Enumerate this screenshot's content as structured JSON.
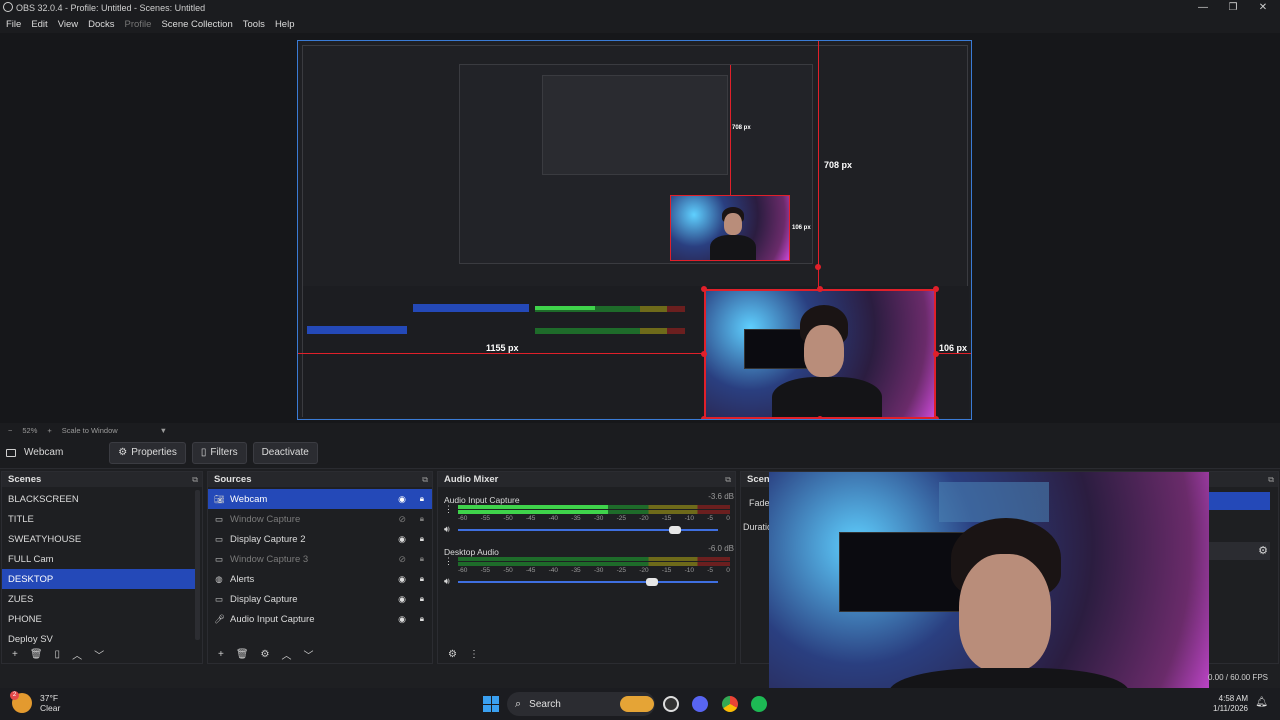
{
  "window": {
    "title": "OBS 32.0.4 - Profile: Untitled - Scenes: Untitled",
    "controls": [
      "—",
      "❐",
      "✕"
    ]
  },
  "menu": [
    "File",
    "Edit",
    "View",
    "Docks",
    "Profile",
    "Scene Collection",
    "Tools",
    "Help"
  ],
  "preview": {
    "measure_top": "708 px",
    "measure_right": "106 px",
    "measure_left": "1155 px",
    "inner_measure": "708 px",
    "inner_measure2": "106 px"
  },
  "zoom": {
    "minus": "−",
    "value": "52%",
    "plus": "+",
    "mode": "Scale to Window",
    "caret": "▼"
  },
  "source_bar": {
    "name": "Webcam",
    "properties": "Properties",
    "filters": "Filters",
    "deactivate": "Deactivate"
  },
  "scenes": {
    "title": "Scenes",
    "items": [
      "BLACKSCREEN",
      "TITLE",
      "SWEATYHOUSE",
      "FULL Cam",
      "DESKTOP",
      "ZUES",
      "PHONE",
      "Deploy SV"
    ],
    "selected": 4
  },
  "sources": {
    "title": "Sources",
    "items": [
      {
        "name": "Webcam",
        "icon": "camera-icon",
        "visible": true,
        "selected": true
      },
      {
        "name": "Window Capture",
        "icon": "window-icon",
        "visible": false
      },
      {
        "name": "Display Capture 2",
        "icon": "display-icon",
        "visible": true
      },
      {
        "name": "Window Capture 3",
        "icon": "window-icon",
        "visible": false
      },
      {
        "name": "Alerts",
        "icon": "globe-icon",
        "visible": true
      },
      {
        "name": "Display Capture",
        "icon": "display-icon",
        "visible": true
      },
      {
        "name": "Audio Input Capture",
        "icon": "mic-icon",
        "visible": true
      }
    ]
  },
  "audio_mixer": {
    "title": "Audio Mixer",
    "channels": [
      {
        "name": "Audio Input Capture",
        "db": "-3.6 dB",
        "level": 0.55,
        "volume": 0.85
      },
      {
        "name": "Desktop Audio",
        "db": "-6.0 dB",
        "level": 0.0,
        "volume": 0.76
      }
    ],
    "scale": [
      "-60",
      "-55",
      "-50",
      "-45",
      "-40",
      "-35",
      "-30",
      "-25",
      "-20",
      "-15",
      "-10",
      "-5",
      "0"
    ]
  },
  "scene_transitions": {
    "title": "Scene",
    "fade": "Fade",
    "duration": "Duratio"
  },
  "status": {
    "fps": "0.00 / 60.00 FPS"
  },
  "taskbar": {
    "weather_temp": "37°F",
    "weather_desc": "Clear",
    "weather_badge": "2",
    "search": "Search",
    "time": "4:58 AM",
    "date": "1/11/2026"
  }
}
